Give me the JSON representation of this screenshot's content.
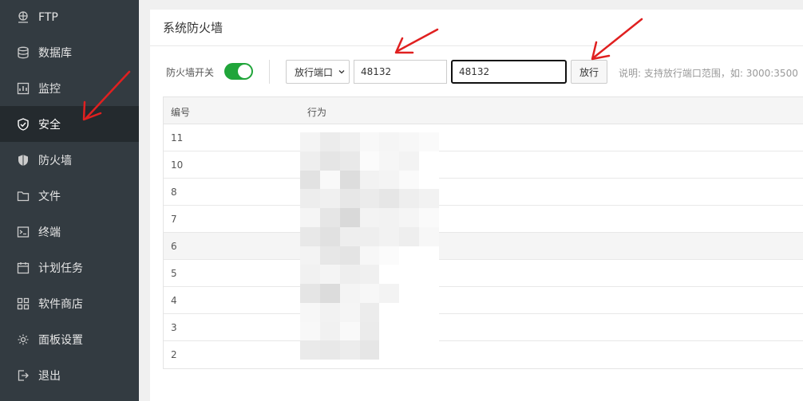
{
  "sidebar": {
    "items": [
      {
        "label": "FTP",
        "icon": "ftp-icon"
      },
      {
        "label": "数据库",
        "icon": "database-icon"
      },
      {
        "label": "监控",
        "icon": "monitor-icon"
      },
      {
        "label": "安全",
        "icon": "shield-icon",
        "active": true
      },
      {
        "label": "防火墙",
        "icon": "firewall-icon"
      },
      {
        "label": "文件",
        "icon": "folder-icon"
      },
      {
        "label": "终端",
        "icon": "terminal-icon"
      },
      {
        "label": "计划任务",
        "icon": "task-icon"
      },
      {
        "label": "软件商店",
        "icon": "apps-icon"
      },
      {
        "label": "面板设置",
        "icon": "gear-icon"
      },
      {
        "label": "退出",
        "icon": "logout-icon"
      }
    ]
  },
  "panel": {
    "title": "系统防火墙"
  },
  "toolbar": {
    "firewall_switch_label": "防火墙开关",
    "firewall_enabled": true,
    "select_value": "放行端口",
    "port_input_1": "48132",
    "port_input_2": "48132",
    "allow_button": "放行",
    "help": "说明: 支持放行端口范围，如: 3000:3500"
  },
  "table": {
    "headers": [
      "编号",
      "行为"
    ],
    "rows": [
      "11",
      "10",
      "8",
      "7",
      "6",
      "5",
      "4",
      "3",
      "2"
    ]
  },
  "colors": {
    "sidebar_bg": "#333b41",
    "sidebar_active": "#242a2e",
    "toggle_on": "#20a53a",
    "annotation_arrow": "#e02020"
  }
}
